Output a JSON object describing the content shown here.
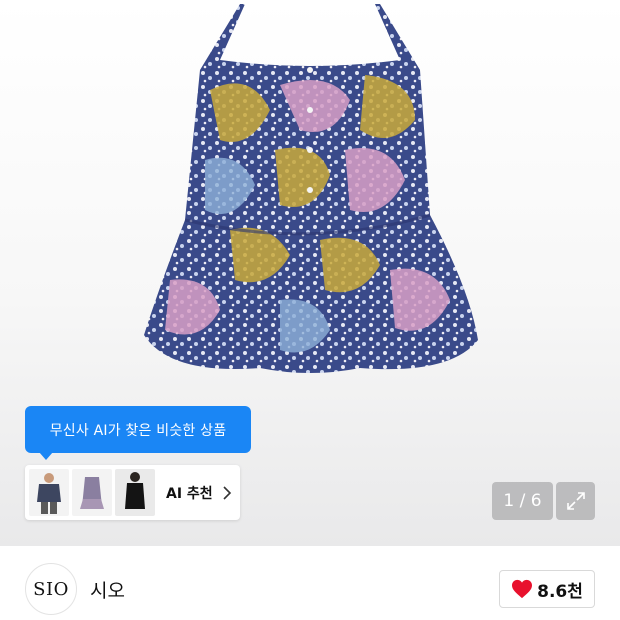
{
  "gallery": {
    "ai_tooltip_text": "무신사 AI가 찾은 비슷한 상품",
    "ai_recommend_label": "AI 추천",
    "counter": "1 / 6"
  },
  "brand": {
    "logo_text": "SIO",
    "name": "시오"
  },
  "like": {
    "count": "8.6천",
    "heart_color": "#e8112d"
  },
  "icons": [
    "chevron-right-icon",
    "expand-icon",
    "heart-icon"
  ]
}
